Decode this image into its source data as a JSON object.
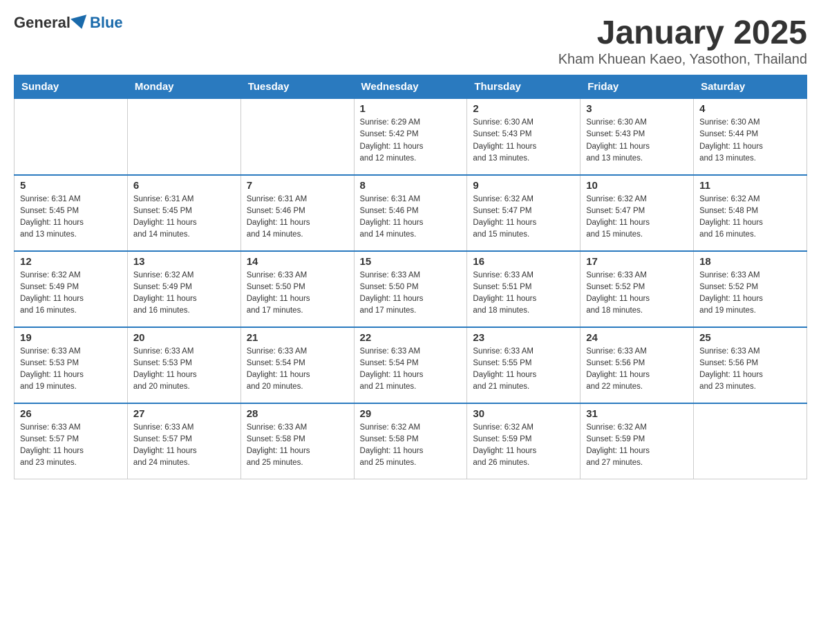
{
  "header": {
    "logo_general": "General",
    "logo_blue": "Blue",
    "month_title": "January 2025",
    "location": "Kham Khuean Kaeo, Yasothon, Thailand"
  },
  "days_of_week": [
    "Sunday",
    "Monday",
    "Tuesday",
    "Wednesday",
    "Thursday",
    "Friday",
    "Saturday"
  ],
  "weeks": [
    [
      {
        "day": "",
        "info": ""
      },
      {
        "day": "",
        "info": ""
      },
      {
        "day": "",
        "info": ""
      },
      {
        "day": "1",
        "info": "Sunrise: 6:29 AM\nSunset: 5:42 PM\nDaylight: 11 hours\nand 12 minutes."
      },
      {
        "day": "2",
        "info": "Sunrise: 6:30 AM\nSunset: 5:43 PM\nDaylight: 11 hours\nand 13 minutes."
      },
      {
        "day": "3",
        "info": "Sunrise: 6:30 AM\nSunset: 5:43 PM\nDaylight: 11 hours\nand 13 minutes."
      },
      {
        "day": "4",
        "info": "Sunrise: 6:30 AM\nSunset: 5:44 PM\nDaylight: 11 hours\nand 13 minutes."
      }
    ],
    [
      {
        "day": "5",
        "info": "Sunrise: 6:31 AM\nSunset: 5:45 PM\nDaylight: 11 hours\nand 13 minutes."
      },
      {
        "day": "6",
        "info": "Sunrise: 6:31 AM\nSunset: 5:45 PM\nDaylight: 11 hours\nand 14 minutes."
      },
      {
        "day": "7",
        "info": "Sunrise: 6:31 AM\nSunset: 5:46 PM\nDaylight: 11 hours\nand 14 minutes."
      },
      {
        "day": "8",
        "info": "Sunrise: 6:31 AM\nSunset: 5:46 PM\nDaylight: 11 hours\nand 14 minutes."
      },
      {
        "day": "9",
        "info": "Sunrise: 6:32 AM\nSunset: 5:47 PM\nDaylight: 11 hours\nand 15 minutes."
      },
      {
        "day": "10",
        "info": "Sunrise: 6:32 AM\nSunset: 5:47 PM\nDaylight: 11 hours\nand 15 minutes."
      },
      {
        "day": "11",
        "info": "Sunrise: 6:32 AM\nSunset: 5:48 PM\nDaylight: 11 hours\nand 16 minutes."
      }
    ],
    [
      {
        "day": "12",
        "info": "Sunrise: 6:32 AM\nSunset: 5:49 PM\nDaylight: 11 hours\nand 16 minutes."
      },
      {
        "day": "13",
        "info": "Sunrise: 6:32 AM\nSunset: 5:49 PM\nDaylight: 11 hours\nand 16 minutes."
      },
      {
        "day": "14",
        "info": "Sunrise: 6:33 AM\nSunset: 5:50 PM\nDaylight: 11 hours\nand 17 minutes."
      },
      {
        "day": "15",
        "info": "Sunrise: 6:33 AM\nSunset: 5:50 PM\nDaylight: 11 hours\nand 17 minutes."
      },
      {
        "day": "16",
        "info": "Sunrise: 6:33 AM\nSunset: 5:51 PM\nDaylight: 11 hours\nand 18 minutes."
      },
      {
        "day": "17",
        "info": "Sunrise: 6:33 AM\nSunset: 5:52 PM\nDaylight: 11 hours\nand 18 minutes."
      },
      {
        "day": "18",
        "info": "Sunrise: 6:33 AM\nSunset: 5:52 PM\nDaylight: 11 hours\nand 19 minutes."
      }
    ],
    [
      {
        "day": "19",
        "info": "Sunrise: 6:33 AM\nSunset: 5:53 PM\nDaylight: 11 hours\nand 19 minutes."
      },
      {
        "day": "20",
        "info": "Sunrise: 6:33 AM\nSunset: 5:53 PM\nDaylight: 11 hours\nand 20 minutes."
      },
      {
        "day": "21",
        "info": "Sunrise: 6:33 AM\nSunset: 5:54 PM\nDaylight: 11 hours\nand 20 minutes."
      },
      {
        "day": "22",
        "info": "Sunrise: 6:33 AM\nSunset: 5:54 PM\nDaylight: 11 hours\nand 21 minutes."
      },
      {
        "day": "23",
        "info": "Sunrise: 6:33 AM\nSunset: 5:55 PM\nDaylight: 11 hours\nand 21 minutes."
      },
      {
        "day": "24",
        "info": "Sunrise: 6:33 AM\nSunset: 5:56 PM\nDaylight: 11 hours\nand 22 minutes."
      },
      {
        "day": "25",
        "info": "Sunrise: 6:33 AM\nSunset: 5:56 PM\nDaylight: 11 hours\nand 23 minutes."
      }
    ],
    [
      {
        "day": "26",
        "info": "Sunrise: 6:33 AM\nSunset: 5:57 PM\nDaylight: 11 hours\nand 23 minutes."
      },
      {
        "day": "27",
        "info": "Sunrise: 6:33 AM\nSunset: 5:57 PM\nDaylight: 11 hours\nand 24 minutes."
      },
      {
        "day": "28",
        "info": "Sunrise: 6:33 AM\nSunset: 5:58 PM\nDaylight: 11 hours\nand 25 minutes."
      },
      {
        "day": "29",
        "info": "Sunrise: 6:32 AM\nSunset: 5:58 PM\nDaylight: 11 hours\nand 25 minutes."
      },
      {
        "day": "30",
        "info": "Sunrise: 6:32 AM\nSunset: 5:59 PM\nDaylight: 11 hours\nand 26 minutes."
      },
      {
        "day": "31",
        "info": "Sunrise: 6:32 AM\nSunset: 5:59 PM\nDaylight: 11 hours\nand 27 minutes."
      },
      {
        "day": "",
        "info": ""
      }
    ]
  ]
}
